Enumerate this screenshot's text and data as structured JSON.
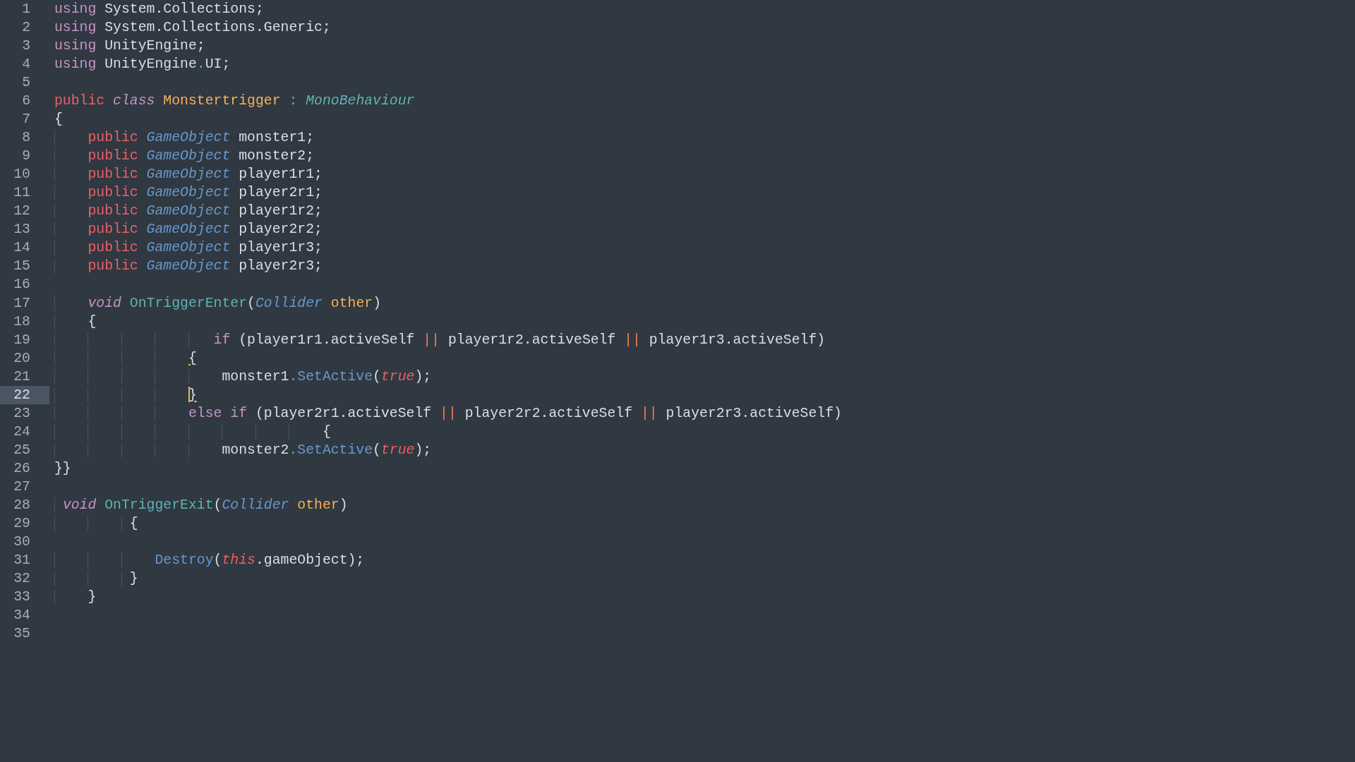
{
  "editor": {
    "lines": [
      {
        "number": "1",
        "selected": false,
        "tokens": [
          {
            "text": "using",
            "kind": "keyword"
          },
          {
            "text": " System.Collections;",
            "kind": "plain"
          }
        ]
      },
      {
        "number": "2",
        "selected": false,
        "tokens": [
          {
            "text": "using",
            "kind": "keyword"
          },
          {
            "text": " System.Collections.Generic;",
            "kind": "plain"
          }
        ]
      },
      {
        "number": "3",
        "selected": false,
        "tokens": [
          {
            "text": "using",
            "kind": "keyword"
          },
          {
            "text": " UnityEngine;",
            "kind": "plain"
          }
        ]
      },
      {
        "number": "4",
        "selected": false,
        "tokens": [
          {
            "text": "using",
            "kind": "keyword"
          },
          {
            "text": " UnityEngine",
            "kind": "plain"
          },
          {
            "text": ".",
            "kind": "punct"
          },
          {
            "text": "UI;",
            "kind": "plain"
          }
        ]
      },
      {
        "number": "5",
        "selected": false
      },
      {
        "number": "6",
        "selected": false,
        "tokens": [
          {
            "text": "public ",
            "kind": "storage"
          },
          {
            "text": "class ",
            "kind": "italic-keyword"
          },
          {
            "text": "Monstertrigger ",
            "kind": "class-name"
          },
          {
            "text": ": ",
            "kind": "punct"
          },
          {
            "text": "MonoBehaviour",
            "kind": "inherited"
          }
        ]
      },
      {
        "number": "7",
        "selected": false,
        "tokens": [
          {
            "text": "{",
            "kind": "plain"
          }
        ]
      },
      {
        "number": "8",
        "selected": false,
        "tokens": [
          {
            "text": "    public ",
            "kind": "storage"
          },
          {
            "text": "GameObject",
            "kind": "type"
          },
          {
            "text": " monster1;",
            "kind": "plain"
          }
        ]
      },
      {
        "number": "9",
        "selected": false,
        "tokens": [
          {
            "text": "    public ",
            "kind": "storage"
          },
          {
            "text": "GameObject",
            "kind": "type"
          },
          {
            "text": " monster2;",
            "kind": "plain"
          }
        ]
      },
      {
        "number": "10",
        "selected": false,
        "tokens": [
          {
            "text": "    public ",
            "kind": "storage"
          },
          {
            "text": "GameObject",
            "kind": "type"
          },
          {
            "text": " player1r1;",
            "kind": "plain"
          }
        ]
      },
      {
        "number": "11",
        "selected": false,
        "tokens": [
          {
            "text": "    public ",
            "kind": "storage"
          },
          {
            "text": "GameObject",
            "kind": "type"
          },
          {
            "text": " player2r1;",
            "kind": "plain"
          }
        ]
      },
      {
        "number": "12",
        "selected": false,
        "tokens": [
          {
            "text": "    public ",
            "kind": "storage"
          },
          {
            "text": "GameObject",
            "kind": "type"
          },
          {
            "text": " player1r2;",
            "kind": "plain"
          }
        ]
      },
      {
        "number": "13",
        "selected": false,
        "tokens": [
          {
            "text": "    public ",
            "kind": "storage"
          },
          {
            "text": "GameObject",
            "kind": "type"
          },
          {
            "text": " player2r2;",
            "kind": "plain"
          }
        ]
      },
      {
        "number": "14",
        "selected": false,
        "tokens": [
          {
            "text": "    public ",
            "kind": "storage"
          },
          {
            "text": "GameObject",
            "kind": "type"
          },
          {
            "text": " player1r3;",
            "kind": "plain"
          }
        ]
      },
      {
        "number": "15",
        "selected": false,
        "tokens": [
          {
            "text": "    public ",
            "kind": "storage"
          },
          {
            "text": "GameObject",
            "kind": "type"
          },
          {
            "text": " player2r3;",
            "kind": "plain"
          }
        ]
      },
      {
        "number": "16",
        "selected": false
      },
      {
        "number": "17",
        "selected": false,
        "tokens": [
          {
            "text": "    void ",
            "kind": "italic-keyword"
          },
          {
            "text": "OnTriggerEnter",
            "kind": "function"
          },
          {
            "text": "(",
            "kind": "plain"
          },
          {
            "text": "Collider ",
            "kind": "type"
          },
          {
            "text": "other",
            "kind": "param"
          },
          {
            "text": ")",
            "kind": "plain"
          }
        ]
      },
      {
        "number": "18",
        "selected": false,
        "tokens": [
          {
            "text": "    {",
            "kind": "plain"
          }
        ]
      },
      {
        "number": "19",
        "selected": false,
        "tokens": [
          {
            "text": "                   if ",
            "kind": "keyword"
          },
          {
            "text": "(player1r1.activeSelf ",
            "kind": "plain"
          },
          {
            "text": "||",
            "kind": "operator"
          },
          {
            "text": " player1r2.activeSelf ",
            "kind": "plain"
          },
          {
            "text": "||",
            "kind": "operator"
          },
          {
            "text": " player1r3.activeSelf)",
            "kind": "plain"
          }
        ]
      },
      {
        "number": "20",
        "selected": false,
        "tokens": [
          {
            "text": "                {",
            "kind": "brace-match"
          }
        ]
      },
      {
        "number": "21",
        "selected": false,
        "tokens": [
          {
            "text": "                    monster1",
            "kind": "plain"
          },
          {
            "text": ".",
            "kind": "punct"
          },
          {
            "text": "SetActive",
            "kind": "call"
          },
          {
            "text": "(",
            "kind": "plain"
          },
          {
            "text": "true",
            "kind": "constant"
          },
          {
            "text": ");",
            "kind": "plain"
          }
        ]
      },
      {
        "number": "22",
        "selected": true,
        "tokens": [
          {
            "text": "                }",
            "kind": "brace-match"
          }
        ]
      },
      {
        "number": "23",
        "selected": false,
        "tokens": [
          {
            "text": "                else if ",
            "kind": "keyword"
          },
          {
            "text": "(player2r1.activeSelf ",
            "kind": "plain"
          },
          {
            "text": "||",
            "kind": "operator"
          },
          {
            "text": " player2r2.activeSelf ",
            "kind": "plain"
          },
          {
            "text": "||",
            "kind": "operator"
          },
          {
            "text": " player2r3.activeSelf)",
            "kind": "plain"
          }
        ]
      },
      {
        "number": "24",
        "selected": false,
        "tokens": [
          {
            "text": "                                {",
            "kind": "plain"
          }
        ]
      },
      {
        "number": "25",
        "selected": false,
        "tokens": [
          {
            "text": "                    monster2",
            "kind": "plain"
          },
          {
            "text": ".",
            "kind": "punct"
          },
          {
            "text": "SetActive",
            "kind": "call"
          },
          {
            "text": "(",
            "kind": "plain"
          },
          {
            "text": "true",
            "kind": "constant"
          },
          {
            "text": ");",
            "kind": "plain"
          }
        ]
      },
      {
        "number": "26",
        "selected": false,
        "tokens": [
          {
            "text": "}}",
            "kind": "plain"
          }
        ]
      },
      {
        "number": "27",
        "selected": false
      },
      {
        "number": "28",
        "selected": false,
        "tokens": [
          {
            "text": " void ",
            "kind": "italic-keyword"
          },
          {
            "text": "OnTriggerExit",
            "kind": "function"
          },
          {
            "text": "(",
            "kind": "plain"
          },
          {
            "text": "Collider ",
            "kind": "type"
          },
          {
            "text": "other",
            "kind": "param"
          },
          {
            "text": ")",
            "kind": "plain"
          }
        ]
      },
      {
        "number": "29",
        "selected": false,
        "tokens": [
          {
            "text": "         {",
            "kind": "plain"
          }
        ]
      },
      {
        "number": "30",
        "selected": false
      },
      {
        "number": "31",
        "selected": false,
        "tokens": [
          {
            "text": "            Destroy",
            "kind": "call"
          },
          {
            "text": "(",
            "kind": "plain"
          },
          {
            "text": "this",
            "kind": "constant"
          },
          {
            "text": ".gameObject);",
            "kind": "plain"
          }
        ]
      },
      {
        "number": "32",
        "selected": false,
        "tokens": [
          {
            "text": "         }",
            "kind": "plain"
          }
        ]
      },
      {
        "number": "33",
        "selected": false,
        "tokens": [
          {
            "text": "    }",
            "kind": "plain"
          }
        ]
      },
      {
        "number": "34",
        "selected": false
      },
      {
        "number": "35",
        "selected": false
      }
    ]
  }
}
